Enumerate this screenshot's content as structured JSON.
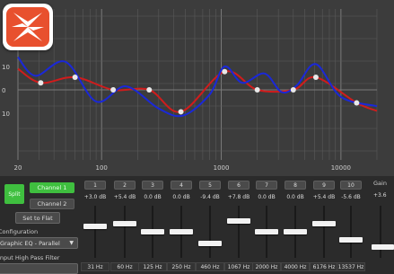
{
  "graph": {
    "x_ticks": [
      "20",
      "100",
      "1000",
      "10000"
    ],
    "y_ticks": [
      "10",
      "0",
      "10"
    ],
    "colors": {
      "red_curve": "#d01c1c",
      "blue_curve": "#1a28d8",
      "points": "#e8e8e8",
      "grid": "#5a5a5a",
      "background": "#3c3c3c"
    }
  },
  "logo": {
    "icon": "orange-starburst-app-icon"
  },
  "controls": {
    "split_label": "Split",
    "channel_1_label": "Channel 1",
    "channel_2_label": "Channel 2",
    "set_flat_label": "Set to Flat",
    "configuration_label": "Configuration",
    "configuration_value": "Graphic EQ - Parallel",
    "hpf_label": "Input High Pass Filter",
    "gain_label": "Gain",
    "gain_value": "+3.6"
  },
  "bands": [
    {
      "num": "1",
      "gain": "+3.0 dB",
      "freq": "31 Hz",
      "level": 0.62
    },
    {
      "num": "2",
      "gain": "+5.4 dB",
      "freq": "60 Hz",
      "level": 0.68
    },
    {
      "num": "3",
      "gain": "0.0 dB",
      "freq": "125 Hz",
      "level": 0.5
    },
    {
      "num": "4",
      "gain": "0.0 dB",
      "freq": "250 Hz",
      "level": 0.5
    },
    {
      "num": "5",
      "gain": "-9.4 dB",
      "freq": "460 Hz",
      "level": 0.25
    },
    {
      "num": "6",
      "gain": "+7.8 dB",
      "freq": "1067 Hz",
      "level": 0.73
    },
    {
      "num": "7",
      "gain": "0.0 dB",
      "freq": "2000 Hz",
      "level": 0.5
    },
    {
      "num": "8",
      "gain": "0.0 dB",
      "freq": "4000 Hz",
      "level": 0.5
    },
    {
      "num": "9",
      "gain": "+5.4 dB",
      "freq": "6176 Hz",
      "level": 0.68
    },
    {
      "num": "10",
      "gain": "-5.6 dB",
      "freq": "13537 Hz",
      "level": 0.33
    }
  ]
}
